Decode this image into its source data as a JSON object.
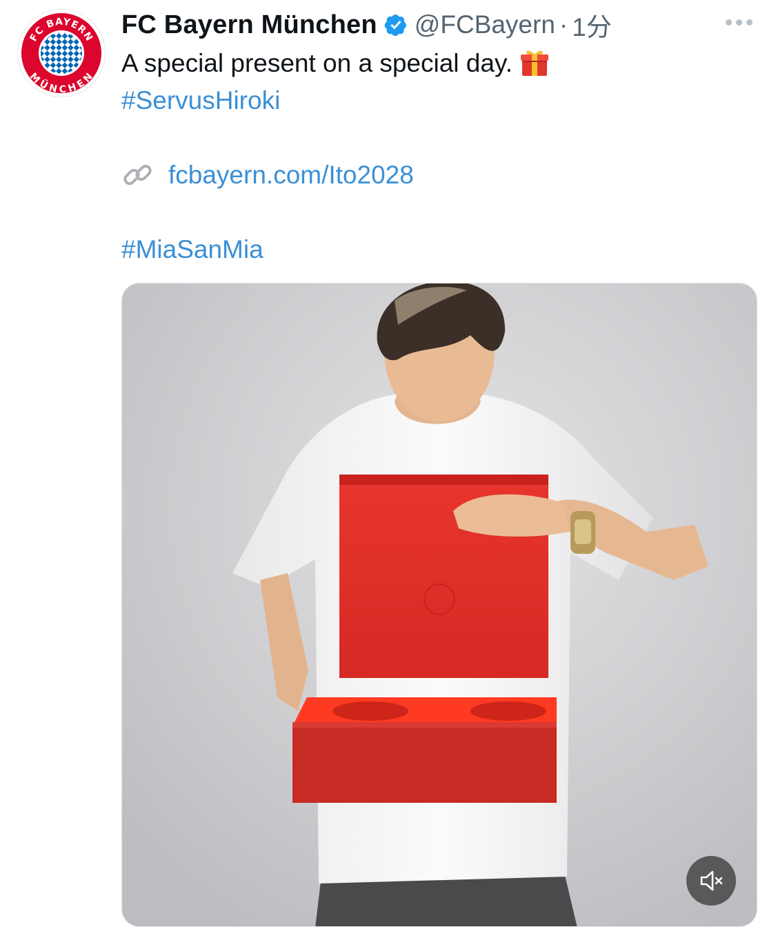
{
  "tweet": {
    "author": {
      "display_name": "FC Bayern München",
      "handle": "@FCBayern",
      "separator": "·",
      "time": "1分",
      "avatar_logo_text": [
        "FC BAYERN",
        "MÜNCHEN"
      ],
      "verified": true
    },
    "text": {
      "line1": "A special present on a special day.",
      "line1_emoji": "gift-emoji",
      "hashtag1": "#ServusHiroki",
      "link_icon": "link-icon",
      "link": "fcbayern.com/Ito2028",
      "hashtag2": "#MiaSanMia"
    },
    "media": {
      "type": "video",
      "description_icon": "video-thumbnail",
      "mute_icon": "speaker-muted-icon"
    },
    "more_icon": "more-horizontal-icon"
  },
  "colors": {
    "text_primary": "#0f1419",
    "text_secondary": "#536471",
    "link": "#3a8fd6",
    "verified": "#1d9bf0",
    "bayern_red": "#dc052d",
    "bayern_blue": "#0066b2"
  }
}
